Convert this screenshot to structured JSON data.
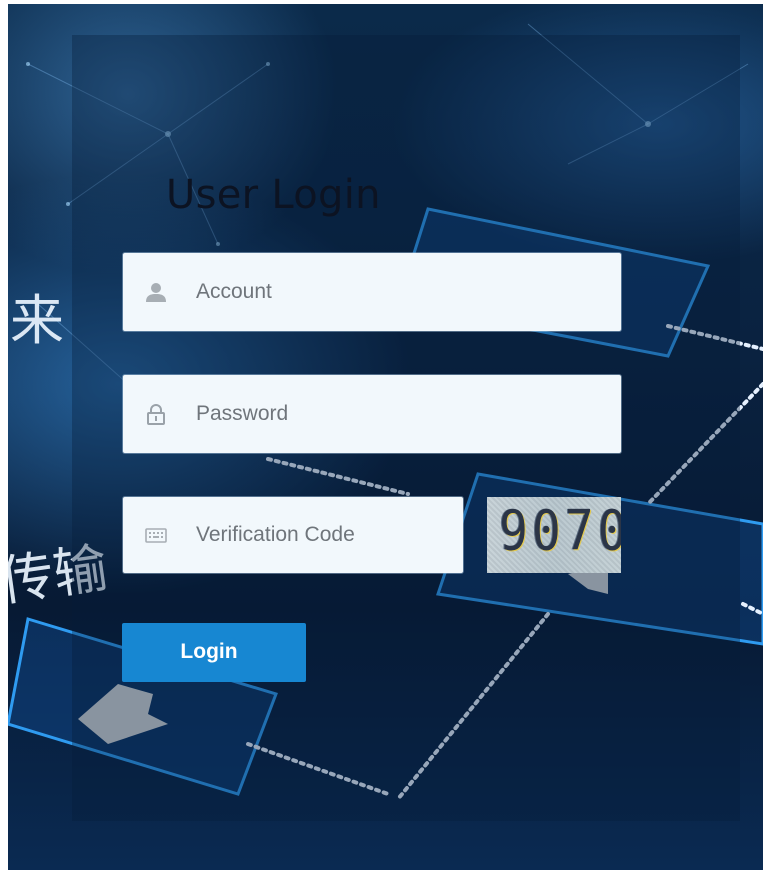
{
  "login": {
    "title": "User Login",
    "account_placeholder": "Account",
    "password_placeholder": "Password",
    "code_placeholder": "Verification Code",
    "captcha_text": "9070",
    "submit_label": "Login",
    "background_chars": [
      "来",
      "传输"
    ]
  },
  "icons": {
    "account": "user-icon",
    "password": "lock-icon",
    "code": "keyboard-icon"
  },
  "colors": {
    "button": "#1787d2",
    "input_bg": "#f2f8fc",
    "background": "#0a2240",
    "accent": "#2f8fe6"
  }
}
